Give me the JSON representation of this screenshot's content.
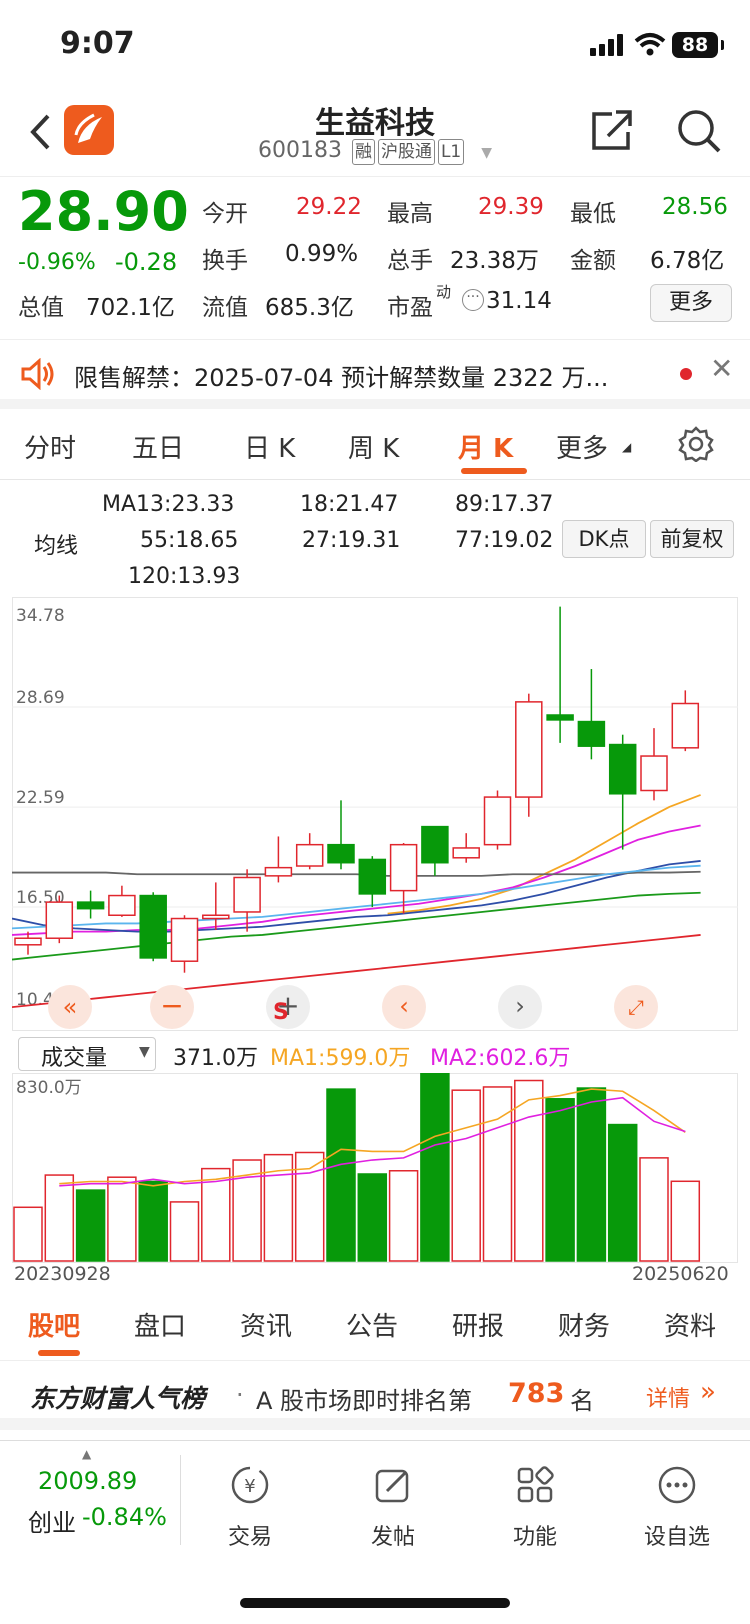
{
  "status_bar": {
    "time": "9:07",
    "battery": "88"
  },
  "header": {
    "title": "生益科技",
    "code": "600183",
    "tags": [
      "融",
      "沪股通",
      "L1"
    ]
  },
  "quote": {
    "price": "28.90",
    "change_pct": "-0.96%",
    "change": "-0.28",
    "fields": [
      {
        "label": "今开",
        "value": "29.22",
        "color": "red"
      },
      {
        "label": "最高",
        "value": "29.39",
        "color": "red"
      },
      {
        "label": "最低",
        "value": "28.56",
        "color": "green"
      },
      {
        "label": "换手",
        "value": "0.99%",
        "color": "dark"
      },
      {
        "label": "总手",
        "value": "23.38万",
        "color": "dark"
      },
      {
        "label": "金额",
        "value": "6.78亿",
        "color": "dark"
      },
      {
        "label": "总值",
        "value": "702.1亿",
        "color": "dark"
      },
      {
        "label": "流值",
        "value": "685.3亿",
        "color": "dark"
      },
      {
        "label": "市盈",
        "value": "31.14",
        "color": "dark",
        "sup": "动"
      }
    ],
    "more_label": "更多"
  },
  "notice": {
    "text": "限售解禁：2025-07-04 预计解禁数量 2322 万..."
  },
  "period_tabs": {
    "items": [
      "分时",
      "五日",
      "日 K",
      "周 K",
      "月 K",
      "更多"
    ],
    "active": 4
  },
  "ma_legend": {
    "label": "均线",
    "items": [
      {
        "text": "MA13:23.33",
        "color": "#f5a623"
      },
      {
        "text": "18:21.47",
        "color": "#e020e0"
      },
      {
        "text": "89:17.37",
        "color": "#1a9a1a"
      },
      {
        "text": "55:18.65",
        "color": "#666666"
      },
      {
        "text": "27:19.31",
        "color": "#2e4ea8"
      },
      {
        "text": "77:19.02",
        "color": "#5bb5ee"
      },
      {
        "text": "120:13.93",
        "color": "#e0262d"
      }
    ],
    "dk_label": "DK点",
    "fuquan_label": "前复权"
  },
  "chart_data": {
    "type": "candlestick",
    "period": "monthly",
    "y_ticks": [
      "34.78",
      "28.69",
      "22.59",
      "16.50",
      "10.41"
    ],
    "ylim": [
      10.41,
      34.78
    ],
    "candles": [
      {
        "o": 14.2,
        "h": 15.0,
        "l": 13.6,
        "c": 14.6
      },
      {
        "o": 14.6,
        "h": 17.2,
        "l": 14.3,
        "c": 16.8
      },
      {
        "o": 16.8,
        "h": 17.5,
        "l": 15.8,
        "c": 16.4
      },
      {
        "o": 16.0,
        "h": 17.8,
        "l": 15.9,
        "c": 17.2
      },
      {
        "o": 17.2,
        "h": 17.4,
        "l": 13.2,
        "c": 13.4
      },
      {
        "o": 13.2,
        "h": 16.0,
        "l": 12.5,
        "c": 15.8
      },
      {
        "o": 15.8,
        "h": 18.0,
        "l": 15.1,
        "c": 16.0
      },
      {
        "o": 16.2,
        "h": 18.8,
        "l": 15.0,
        "c": 18.3
      },
      {
        "o": 18.4,
        "h": 20.8,
        "l": 18.0,
        "c": 18.9
      },
      {
        "o": 19.0,
        "h": 21.0,
        "l": 18.8,
        "c": 20.3
      },
      {
        "o": 20.3,
        "h": 23.0,
        "l": 18.8,
        "c": 19.2
      },
      {
        "o": 19.4,
        "h": 19.6,
        "l": 16.5,
        "c": 17.3
      },
      {
        "o": 17.5,
        "h": 20.4,
        "l": 16.1,
        "c": 20.3
      },
      {
        "o": 21.4,
        "h": 21.4,
        "l": 18.4,
        "c": 19.2
      },
      {
        "o": 19.5,
        "h": 21.0,
        "l": 19.2,
        "c": 20.1
      },
      {
        "o": 20.3,
        "h": 23.6,
        "l": 20.0,
        "c": 23.2
      },
      {
        "o": 23.2,
        "h": 29.5,
        "l": 22.0,
        "c": 29.0
      },
      {
        "o": 28.2,
        "h": 34.8,
        "l": 26.5,
        "c": 27.9
      },
      {
        "o": 27.8,
        "h": 31.0,
        "l": 25.5,
        "c": 26.3
      },
      {
        "o": 26.4,
        "h": 27.0,
        "l": 20.0,
        "c": 23.4
      },
      {
        "o": 23.6,
        "h": 27.4,
        "l": 23.0,
        "c": 25.7
      },
      {
        "o": 26.2,
        "h": 29.7,
        "l": 26.0,
        "c": 28.9
      }
    ],
    "ma_series": [
      {
        "name": "MA13",
        "color": "#f5a623",
        "values": [
          null,
          null,
          null,
          null,
          null,
          null,
          null,
          null,
          null,
          null,
          null,
          null,
          16.1,
          16.3,
          16.6,
          17.0,
          17.6,
          18.5,
          19.4,
          20.5,
          21.6,
          22.6,
          23.33
        ]
      },
      {
        "name": "MA18",
        "color": "#e020e0",
        "values": [
          14.8,
          14.9,
          15.0,
          15.0,
          15.1,
          15.1,
          15.2,
          15.4,
          15.6,
          15.9,
          16.1,
          16.3,
          16.5,
          16.7,
          17.0,
          17.3,
          17.7,
          18.3,
          19.0,
          19.8,
          20.6,
          21.1,
          21.47
        ]
      },
      {
        "name": "MA27",
        "color": "#2e4ea8",
        "values": [
          15.8,
          15.4,
          15.2,
          15.1,
          15.0,
          15.0,
          15.1,
          15.2,
          15.3,
          15.5,
          15.7,
          15.9,
          16.0,
          16.2,
          16.4,
          16.6,
          16.9,
          17.3,
          17.8,
          18.3,
          18.7,
          19.1,
          19.31
        ]
      },
      {
        "name": "MA55",
        "color": "#666666",
        "values": [
          18.6,
          18.6,
          18.6,
          18.6,
          18.5,
          18.5,
          18.5,
          18.5,
          18.5,
          18.5,
          18.5,
          18.5,
          18.4,
          18.4,
          18.4,
          18.4,
          18.5,
          18.5,
          18.5,
          18.5,
          18.6,
          18.6,
          18.65
        ]
      },
      {
        "name": "MA77",
        "color": "#5bb5ee",
        "values": [
          15.2,
          15.3,
          15.4,
          15.5,
          15.5,
          15.6,
          15.7,
          15.8,
          15.9,
          16.1,
          16.3,
          16.5,
          16.7,
          16.9,
          17.1,
          17.3,
          17.6,
          17.9,
          18.2,
          18.5,
          18.7,
          18.9,
          19.02
        ]
      },
      {
        "name": "MA89",
        "color": "#1a9a1a",
        "values": [
          13.3,
          13.5,
          13.7,
          13.9,
          14.1,
          14.3,
          14.5,
          14.7,
          14.8,
          15.0,
          15.2,
          15.4,
          15.6,
          15.8,
          16.0,
          16.2,
          16.4,
          16.6,
          16.8,
          17.0,
          17.2,
          17.3,
          17.37
        ]
      },
      {
        "name": "MA120",
        "color": "#e0262d",
        "values": [
          10.4,
          10.6,
          10.8,
          11.0,
          11.2,
          11.4,
          11.6,
          11.8,
          12.0,
          12.2,
          12.4,
          12.6,
          12.8,
          13.0,
          13.2,
          13.4,
          13.6,
          13.8,
          14.0,
          14.2,
          14.4,
          14.6,
          14.8
        ]
      }
    ],
    "marker": "S",
    "volume": {
      "label": "成交量",
      "current": "371.0万",
      "ma1": "MA1:599.0万",
      "ma2": "MA2:602.6万",
      "max_tick": "830.0万",
      "start_date": "20230928",
      "end_date": "20250620",
      "unit": "万",
      "bars": [
        250,
        400,
        330,
        390,
        370,
        275,
        430,
        470,
        495,
        505,
        800,
        405,
        420,
        875,
        795,
        810,
        840,
        755,
        805,
        635,
        480,
        371
      ],
      "ma1_values": [
        null,
        360,
        370,
        370,
        350,
        370,
        380,
        400,
        420,
        430,
        520,
        510,
        510,
        580,
        620,
        660,
        750,
        770,
        800,
        790,
        700,
        599
      ],
      "ma2_values": [
        null,
        350,
        360,
        360,
        380,
        360,
        370,
        390,
        400,
        410,
        450,
        470,
        480,
        540,
        570,
        620,
        670,
        700,
        740,
        760,
        650,
        602.6
      ]
    }
  },
  "info_tabs": {
    "items": [
      "股吧",
      "盘口",
      "资讯",
      "公告",
      "研报",
      "财务",
      "资料"
    ],
    "active": 0
  },
  "rank_bar": {
    "brand": "东方财富人气榜",
    "prefix": "A 股市场即时排名第",
    "rank": "783",
    "suffix": "名",
    "detail": "详情"
  },
  "dock": {
    "index_value": "2009.89",
    "index_name": "创业",
    "index_change": "-0.84%",
    "items": [
      "交易",
      "发帖",
      "功能",
      "设自选"
    ]
  }
}
